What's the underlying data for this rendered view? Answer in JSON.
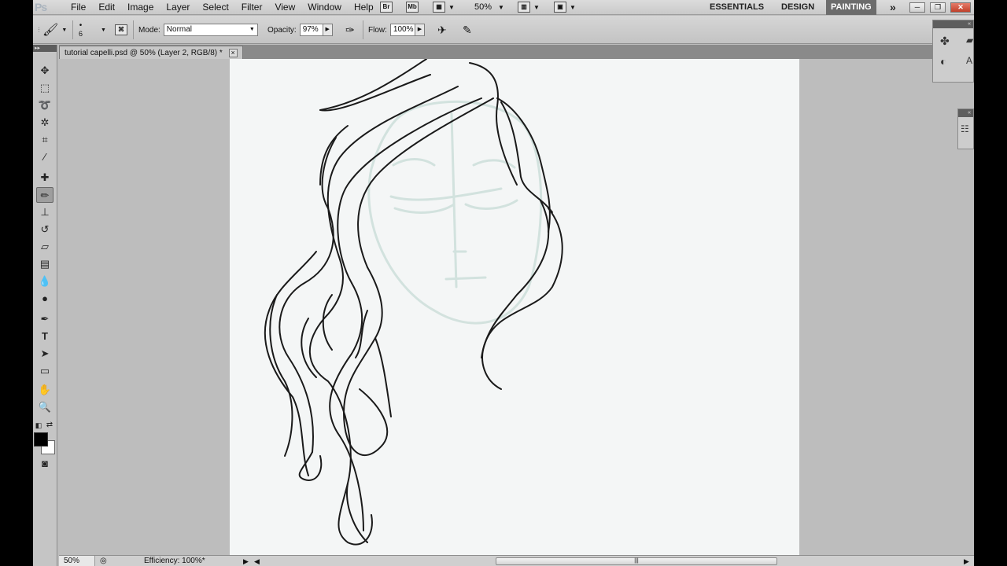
{
  "app": {
    "logo": "Ps"
  },
  "menu": [
    "File",
    "Edit",
    "Image",
    "Layer",
    "Select",
    "Filter",
    "View",
    "Window",
    "Help"
  ],
  "menubar": {
    "bridge_label": "Br",
    "minibridge_label": "Mb",
    "zoom": "50%",
    "workspaces": {
      "essentials": "ESSENTIALS",
      "design": "DESIGN",
      "painting": "PAINTING"
    },
    "more": "»"
  },
  "options": {
    "brush_size": "6",
    "mode_label": "Mode:",
    "mode_value": "Normal",
    "opacity_label": "Opacity:",
    "opacity_value": "97%",
    "flow_label": "Flow:",
    "flow_value": "100%"
  },
  "document": {
    "tab_title": "tutorial capelli.psd @ 50% (Layer 2, RGB/8) *",
    "close": "×"
  },
  "status": {
    "zoom": "50%",
    "info": "Efficiency: 100%*"
  },
  "colors": {
    "foreground": "#000000",
    "background": "#ffffff",
    "active_workspace": "#6c6c6c",
    "canvas": "#f4f6f6",
    "sketch_guide": "#cfe0dc"
  }
}
